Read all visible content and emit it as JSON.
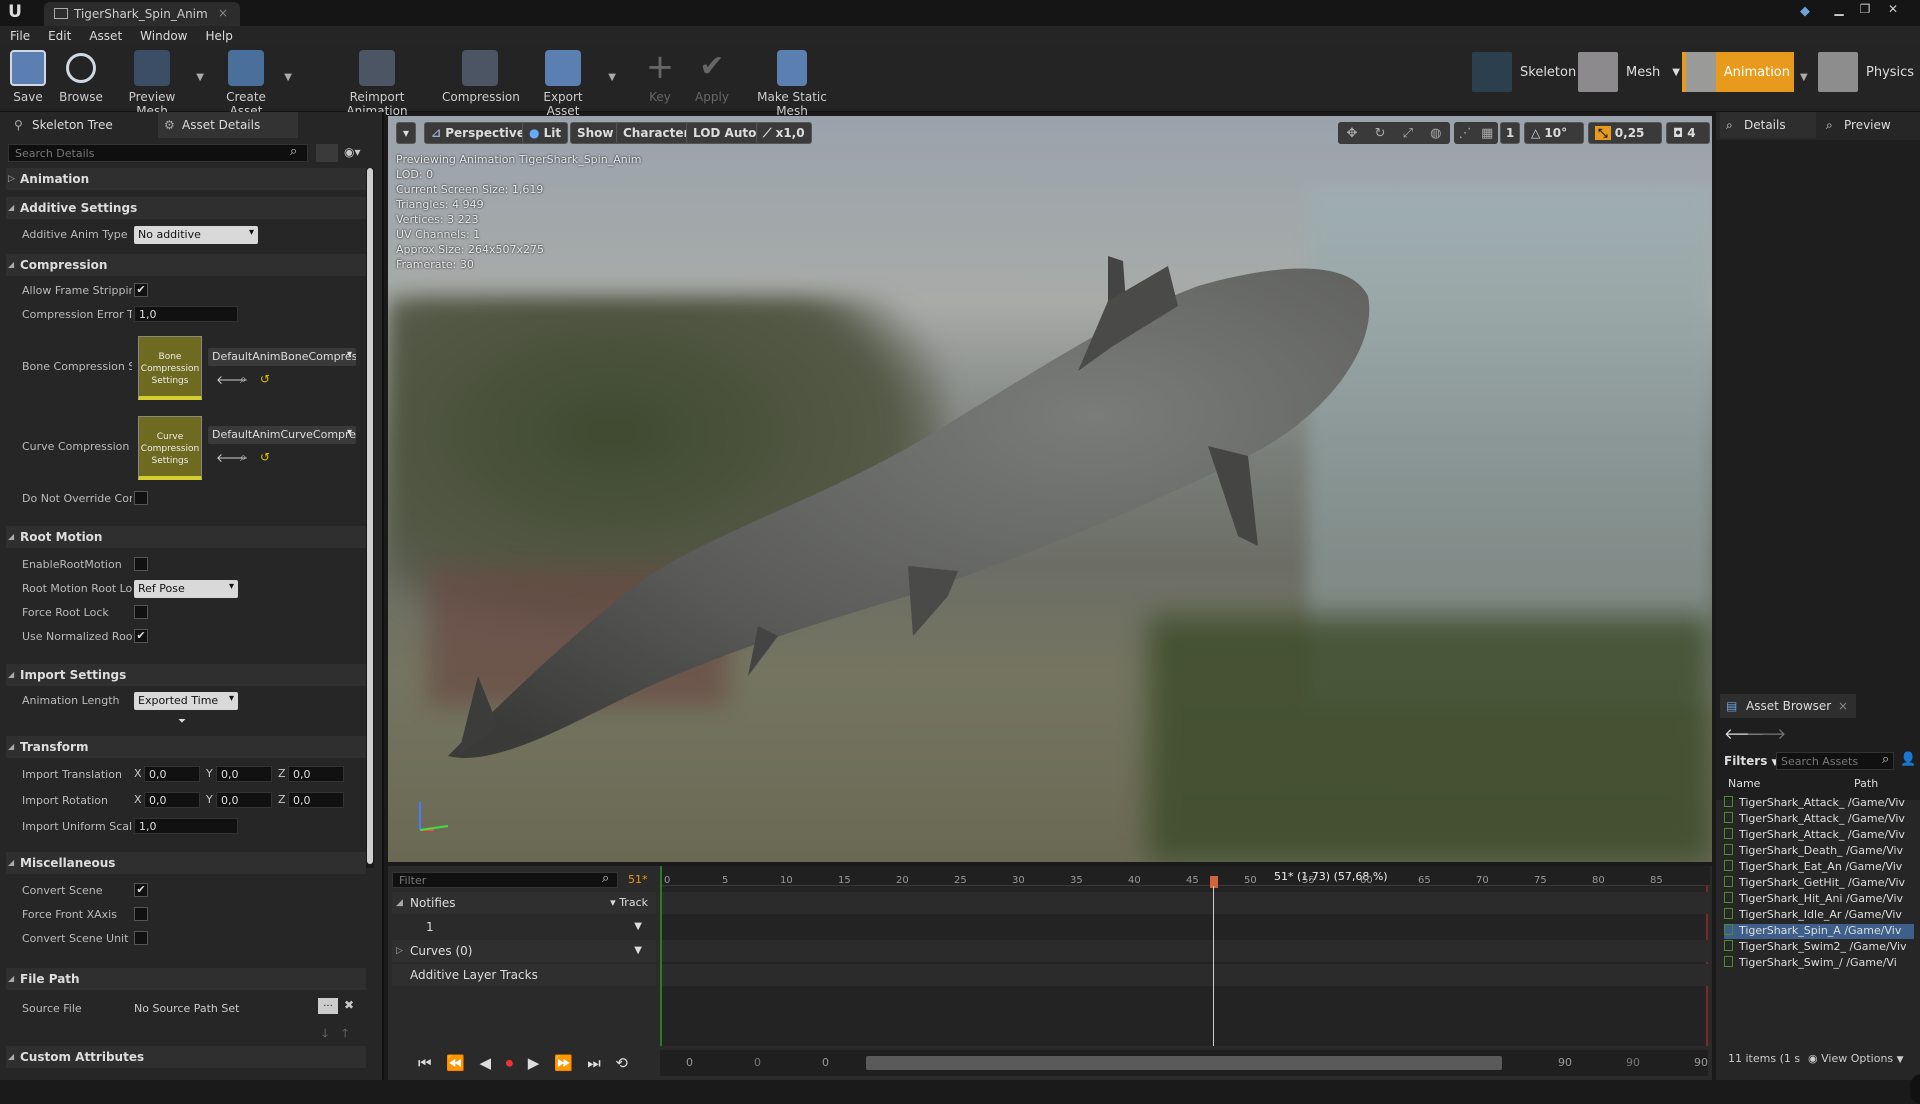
{
  "window": {
    "tab_title": "TigerShark_Spin_Anim",
    "close": "×",
    "minimize": "▁",
    "restore": "❐",
    "close_window": "✕"
  },
  "menu": [
    "File",
    "Edit",
    "Asset",
    "Window",
    "Help"
  ],
  "toolbar": {
    "save": "Save",
    "browse": "Browse",
    "preview_mesh": "Preview Mesh",
    "create_asset": "Create Asset",
    "reimport_animation": "Reimport Animation",
    "compression": "Compression",
    "export_asset": "Export Asset",
    "key": "Key",
    "apply": "Apply",
    "make_static_mesh": "Make Static Mesh"
  },
  "modes": {
    "skeleton": "Skeleton",
    "mesh": "Mesh",
    "animation": "Animation",
    "physics": "Physics"
  },
  "left_tabs": {
    "skeleton_tree": "Skeleton Tree",
    "asset_details": "Asset Details"
  },
  "details": {
    "search_placeholder": "Search Details",
    "sections": {
      "animation": "Animation",
      "additive": "Additive Settings",
      "compression": "Compression",
      "root_motion": "Root Motion",
      "import": "Import Settings",
      "transform": "Transform",
      "misc": "Miscellaneous",
      "file_path": "File Path",
      "custom": "Custom Attributes"
    },
    "additive_anim_type": {
      "label": "Additive Anim Type",
      "value": "No additive"
    },
    "allow_frame_stripping": {
      "label": "Allow Frame Stripping",
      "checked": true
    },
    "compression_error": {
      "label": "Compression Error Th",
      "value": "1,0"
    },
    "bone_compression": {
      "label": "Bone Compression Se",
      "thumb": "Bone Compression Settings",
      "value": "DefaultAnimBoneCompres"
    },
    "curve_compression": {
      "label": "Curve Compression S",
      "thumb": "Curve Compression Settings",
      "value": "DefaultAnimCurveCompre"
    },
    "do_not_override": {
      "label": "Do Not Override Com",
      "checked": false
    },
    "enable_root_motion": {
      "label": "EnableRootMotion",
      "checked": false
    },
    "root_motion_root_lock": {
      "label": "Root Motion Root Loc",
      "value": "Ref Pose"
    },
    "force_root_lock": {
      "label": "Force Root Lock",
      "checked": false
    },
    "use_normalized_root": {
      "label": "Use Normalized Root",
      "checked": true
    },
    "animation_length": {
      "label": "Animation Length",
      "value": "Exported Time"
    },
    "import_translation": {
      "label": "Import Translation",
      "x": "0,0",
      "y": "0,0",
      "z": "0,0"
    },
    "import_rotation": {
      "label": "Import Rotation",
      "x": "0,0",
      "y": "0,0",
      "z": "0,0"
    },
    "import_uniform_scale": {
      "label": "Import Uniform Scale",
      "value": "1,0"
    },
    "convert_scene": {
      "label": "Convert Scene",
      "checked": true
    },
    "force_front_xaxis": {
      "label": "Force Front XAxis",
      "checked": false
    },
    "convert_scene_unit": {
      "label": "Convert Scene Unit",
      "checked": false
    },
    "source_file": {
      "label": "Source File",
      "value": "No Source Path Set",
      "browse": "...",
      "clear": "✖"
    },
    "axis_x": "X",
    "axis_y": "Y",
    "axis_z": "Z"
  },
  "viewport": {
    "perspective": "Perspective",
    "lit": "Lit",
    "show": "Show",
    "character": "Character",
    "lod": "LOD Auto",
    "speed": "x1,0",
    "grid_snap": "10°",
    "scale_snap": "0,25",
    "cam_speed": "4",
    "layer": "1",
    "info": [
      "Previewing Animation TigerShark_Spin_Anim",
      "LOD: 0",
      "Current Screen Size: 1,619",
      "Triangles: 4 949",
      "Vertices: 3 223",
      "UV Channels: 1",
      "Approx Size: 264x507x275",
      "Framerate: 30"
    ]
  },
  "timeline": {
    "filter_placeholder": "Filter",
    "frame_marker": "51*",
    "current": "51* (1,73) (57,68 %)",
    "notifies": "Notifies",
    "track": "Track",
    "notify_track": "1",
    "curves": "Curves  (0)",
    "additive_layer": "Additive Layer Tracks",
    "ticks": [
      "0",
      "5",
      "10",
      "15",
      "20",
      "25",
      "30",
      "35",
      "40",
      "45",
      "50",
      "55",
      "60",
      "65",
      "70",
      "75",
      "80",
      "85"
    ],
    "range_start": [
      "0",
      "0",
      "0"
    ],
    "range_end": [
      "90",
      "90",
      "90"
    ]
  },
  "right": {
    "details_tab": "Details",
    "preview_tab": "Preview",
    "asset_browser": "Asset Browser",
    "filters": "Filters",
    "search_placeholder": "Search Assets",
    "col_name": "Name",
    "col_path": "Path",
    "items_count": "11 items (1 s",
    "view_options": "View Options",
    "assets": [
      {
        "name": "TigerShark_Attack_",
        "path": "/Game/Viv"
      },
      {
        "name": "TigerShark_Attack_",
        "path": "/Game/Viv"
      },
      {
        "name": "TigerShark_Attack_",
        "path": "/Game/Viv"
      },
      {
        "name": "TigerShark_Death_",
        "path": "/Game/Viv"
      },
      {
        "name": "TigerShark_Eat_An",
        "path": "/Game/Viv"
      },
      {
        "name": "TigerShark_GetHit_",
        "path": "/Game/Viv"
      },
      {
        "name": "TigerShark_Hit_Ani",
        "path": "/Game/Viv"
      },
      {
        "name": "TigerShark_Idle_Ar",
        "path": "/Game/Viv"
      },
      {
        "name": "TigerShark_Spin_A",
        "path": "/Game/Viv"
      },
      {
        "name": "TigerShark_Swim2_",
        "path": "/Game/Viv"
      },
      {
        "name": "TigerShark_Swim_/",
        "path": "/Game/Vi"
      }
    ]
  },
  "colors": {
    "accent": "#e89a1c",
    "selection": "#3d5f8a",
    "thumb": "#d5cc30"
  }
}
